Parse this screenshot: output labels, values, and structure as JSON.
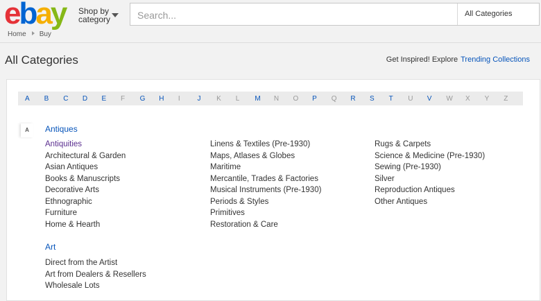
{
  "header": {
    "logo_letters": [
      {
        "ch": "e",
        "color": "#e53238"
      },
      {
        "ch": "b",
        "color": "#0064d2"
      },
      {
        "ch": "a",
        "color": "#f5af02"
      },
      {
        "ch": "y",
        "color": "#86b817"
      }
    ],
    "shop_by_line1": "Shop by",
    "shop_by_line2": "category",
    "search_placeholder": "Search...",
    "search_category": "All Categories"
  },
  "breadcrumb": [
    "Home",
    "Buy"
  ],
  "page_title": "All Categories",
  "inspire": {
    "text": "Get Inspired! Explore",
    "link": "Trending Collections"
  },
  "alphabet": [
    {
      "l": "A",
      "on": true
    },
    {
      "l": "B",
      "on": true
    },
    {
      "l": "C",
      "on": true
    },
    {
      "l": "D",
      "on": true
    },
    {
      "l": "E",
      "on": true
    },
    {
      "l": "F",
      "on": false
    },
    {
      "l": "G",
      "on": true
    },
    {
      "l": "H",
      "on": true
    },
    {
      "l": "I",
      "on": false
    },
    {
      "l": "J",
      "on": true
    },
    {
      "l": "K",
      "on": false
    },
    {
      "l": "L",
      "on": false
    },
    {
      "l": "M",
      "on": true
    },
    {
      "l": "N",
      "on": false
    },
    {
      "l": "O",
      "on": false
    },
    {
      "l": "P",
      "on": true
    },
    {
      "l": "Q",
      "on": false
    },
    {
      "l": "R",
      "on": true
    },
    {
      "l": "S",
      "on": true
    },
    {
      "l": "T",
      "on": true
    },
    {
      "l": "U",
      "on": false
    },
    {
      "l": "V",
      "on": true
    },
    {
      "l": "W",
      "on": false
    },
    {
      "l": "X",
      "on": false
    },
    {
      "l": "Y",
      "on": false
    },
    {
      "l": "Z",
      "on": false
    }
  ],
  "section_letter": "A",
  "antiques": {
    "title": "Antiques",
    "col1": [
      "Antiquities",
      "Architectural & Garden",
      "Asian Antiques",
      "Books & Manuscripts",
      "Decorative Arts",
      "Ethnographic",
      "Furniture",
      "Home & Hearth"
    ],
    "col2": [
      "Linens & Textiles (Pre-1930)",
      "Maps, Atlases & Globes",
      "Maritime",
      "Mercantile, Trades & Factories",
      "Musical Instruments (Pre-1930)",
      "Periods & Styles",
      "Primitives",
      "Restoration & Care"
    ],
    "col3": [
      "Rugs & Carpets",
      "Science & Medicine (Pre-1930)",
      "Sewing (Pre-1930)",
      "Silver",
      "Reproduction Antiques",
      "Other Antiques"
    ]
  },
  "art": {
    "title": "Art",
    "col1": [
      "Direct from the Artist",
      "Art from Dealers & Resellers",
      "Wholesale Lots"
    ]
  }
}
